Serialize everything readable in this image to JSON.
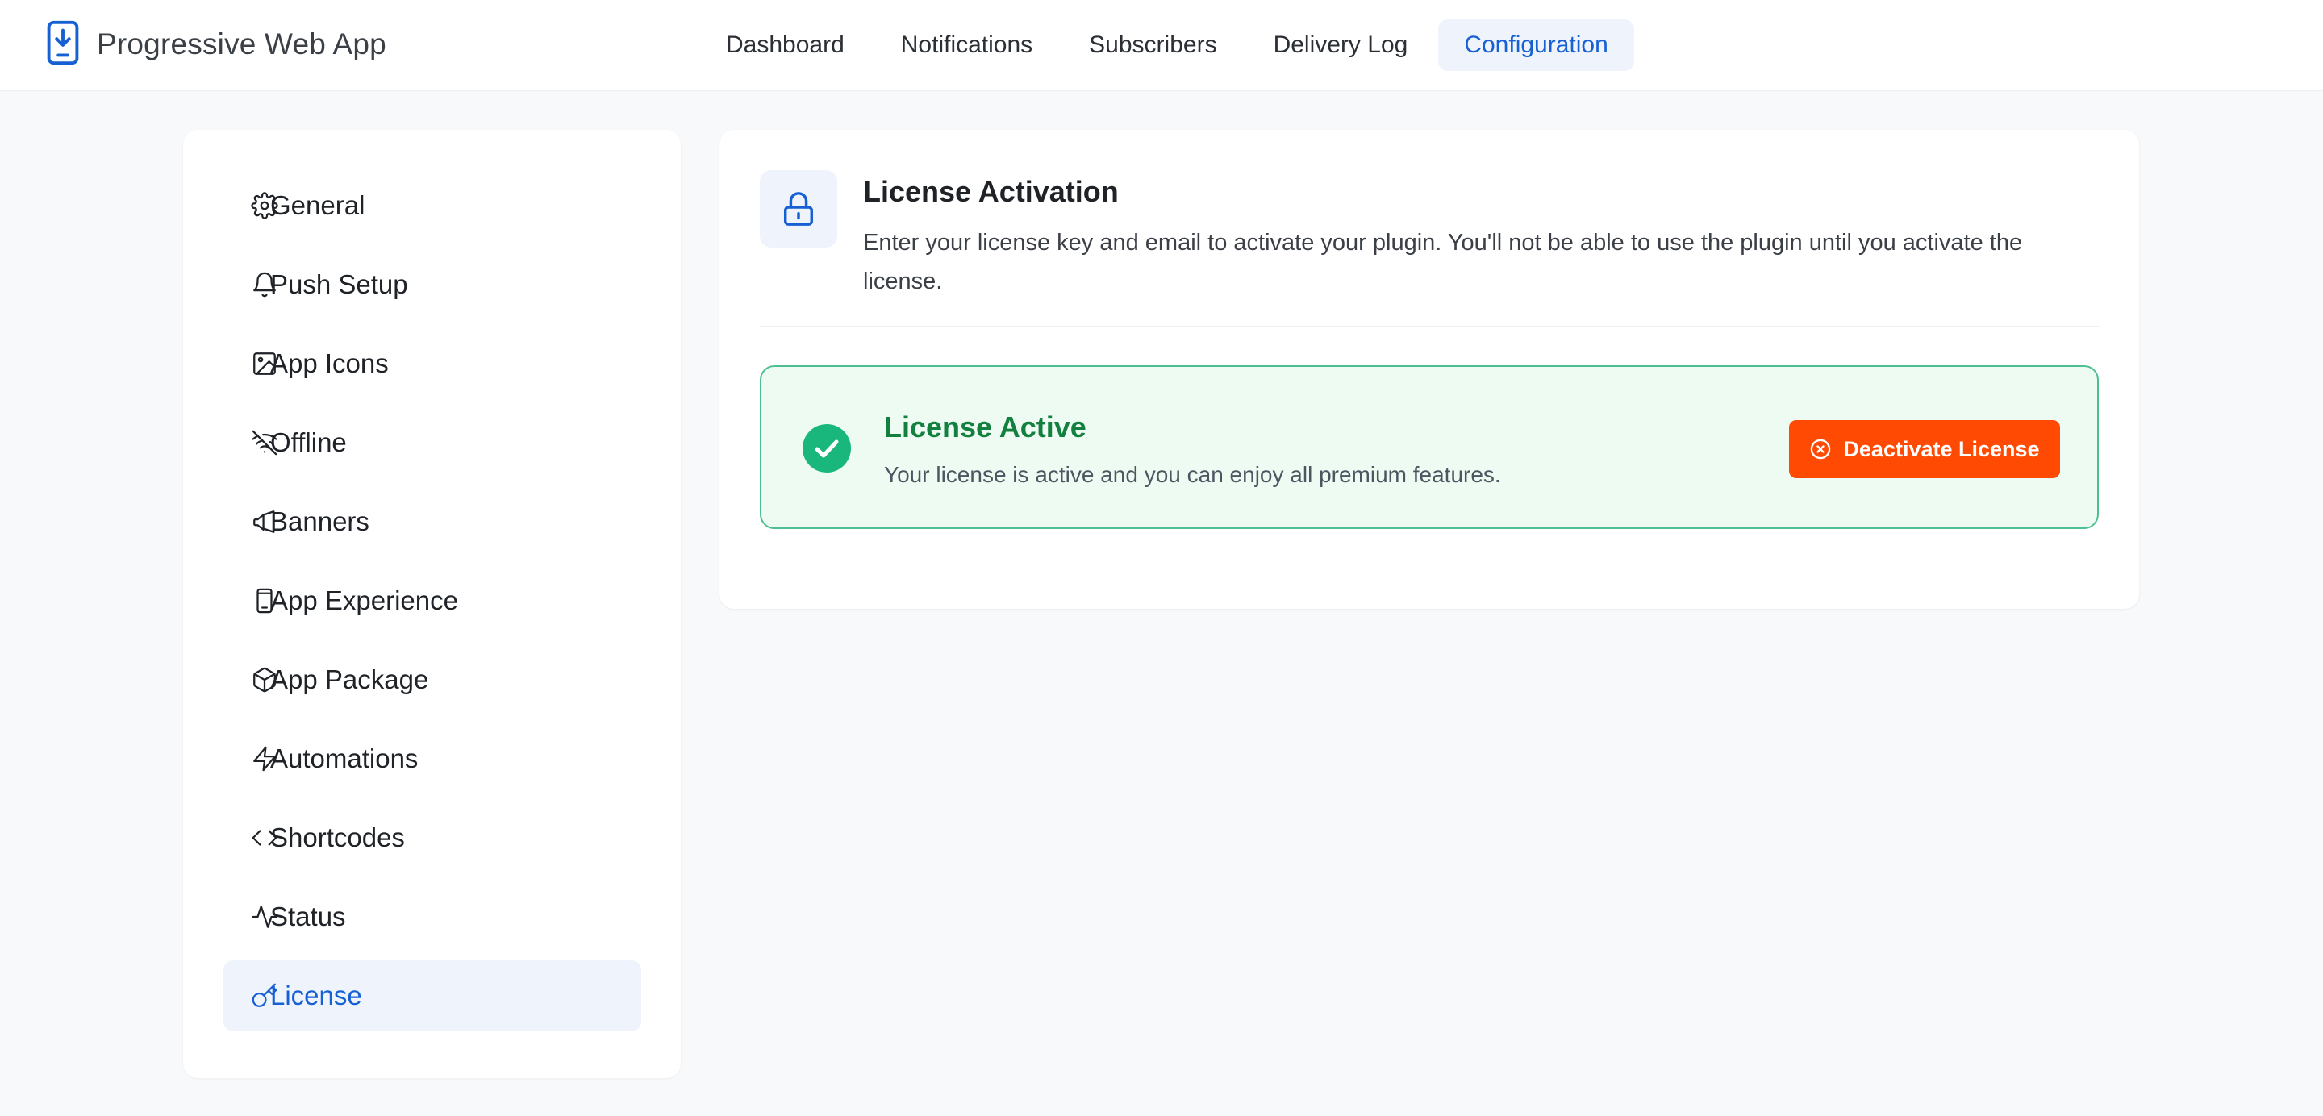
{
  "app": {
    "title": "Progressive Web App",
    "icon": "phone-download-icon",
    "accent": "#1660d4"
  },
  "nav": {
    "tabs": [
      {
        "label": "Dashboard",
        "active": false
      },
      {
        "label": "Notifications",
        "active": false
      },
      {
        "label": "Subscribers",
        "active": false
      },
      {
        "label": "Delivery Log",
        "active": false
      },
      {
        "label": "Configuration",
        "active": true
      }
    ]
  },
  "sidebar": {
    "items": [
      {
        "label": "General",
        "icon": "gear-icon"
      },
      {
        "label": "Push Setup",
        "icon": "bell-icon"
      },
      {
        "label": "App Icons",
        "icon": "image-icon"
      },
      {
        "label": "Offline",
        "icon": "wifi-off-icon"
      },
      {
        "label": "Banners",
        "icon": "megaphone-icon"
      },
      {
        "label": "App Experience",
        "icon": "smartphone-icon"
      },
      {
        "label": "App Package",
        "icon": "package-icon"
      },
      {
        "label": "Automations",
        "icon": "zap-icon"
      },
      {
        "label": "Shortcodes",
        "icon": "code-icon"
      },
      {
        "label": "Status",
        "icon": "activity-icon"
      },
      {
        "label": "License",
        "icon": "key-icon",
        "active": true
      }
    ]
  },
  "license": {
    "title": "License Activation",
    "description": "Enter your license key and email to activate your plugin. You'll not be able to use the plugin until you activate the license.",
    "icon": "lock-icon",
    "status": {
      "title": "License Active",
      "description": "Your license is active and you can enjoy all premium features.",
      "icon": "check-circle-icon",
      "color": "#13803f"
    },
    "deactivate_label": "Deactivate License",
    "deactivate_color": "#ff4a04"
  }
}
